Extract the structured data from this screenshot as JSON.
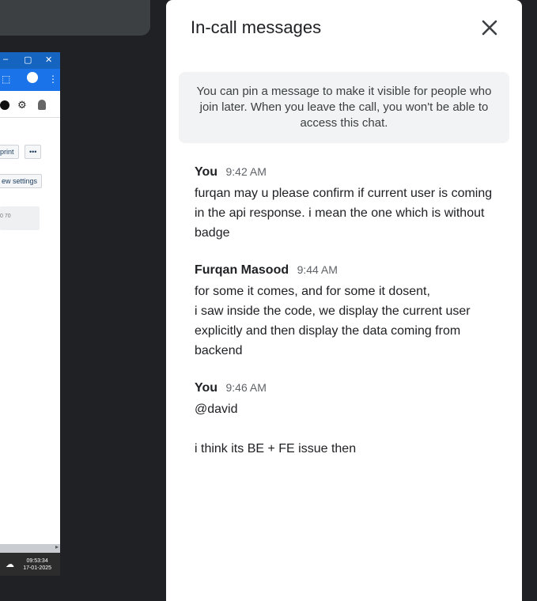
{
  "shared_screen": {
    "window_controls": [
      "–",
      "▢",
      "✕"
    ],
    "toolbar_chips": [
      "print",
      "•••",
      "ew settings"
    ],
    "small_text": "0 70",
    "taskbar_time": "09:53:34",
    "taskbar_date": "17-01-2025"
  },
  "panel": {
    "title": "In-call messages",
    "info": "You can pin a message to make it visible for people who join later. When you leave the call, you won't be able to access this chat."
  },
  "messages": [
    {
      "sender": "You",
      "time": "9:42 AM",
      "text": "furqan may u please confirm if current user is coming in the api response. i mean the one which is without badge"
    },
    {
      "sender": "Furqan Masood",
      "time": "9:44 AM",
      "text": "for some it comes, and for some it dosent,\ni saw inside the code, we display the current user explicitly and then display the data coming from backend"
    },
    {
      "sender": "You",
      "time": "9:46 AM",
      "text": "@david\n\ni think its BE + FE issue then"
    }
  ]
}
